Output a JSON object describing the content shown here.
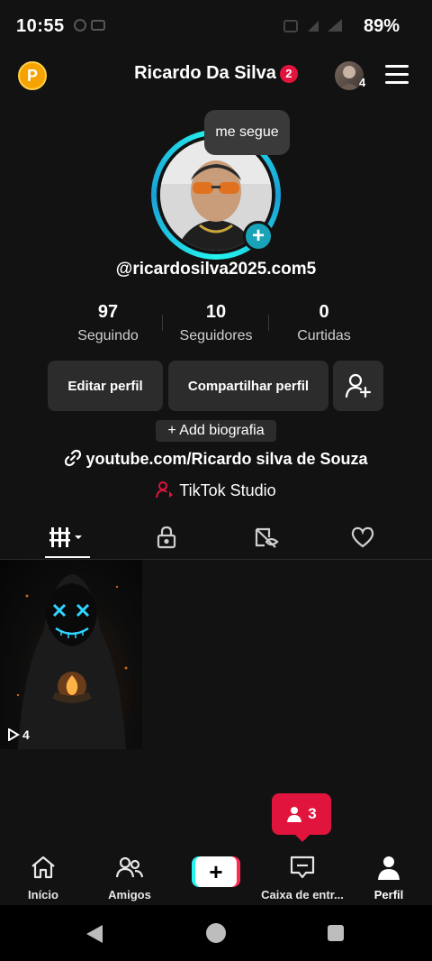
{
  "status_bar": {
    "time": "10:55",
    "battery": "89%"
  },
  "header": {
    "coin_label": "P",
    "title": "Ricardo Da Silva",
    "title_badge": "2",
    "account_count": "4"
  },
  "profile": {
    "bubble_text": "me segue",
    "username": "@ricardosilva2025.com5",
    "stats": [
      {
        "value": "97",
        "label": "Seguindo"
      },
      {
        "value": "10",
        "label": "Seguidores"
      },
      {
        "value": "0",
        "label": "Curtidas"
      }
    ],
    "buttons": {
      "edit": "Editar perfil",
      "share": "Compartilhar perfil"
    },
    "add_bio": "+ Add biografia",
    "link": "youtube.com/Ricardo silva de Souza",
    "studio": "TikTok Studio"
  },
  "tabs": [
    {
      "icon": "grid-icon",
      "active": true
    },
    {
      "icon": "lock-icon",
      "active": false
    },
    {
      "icon": "hidden-tag-icon",
      "active": false
    },
    {
      "icon": "heart-icon",
      "active": false
    }
  ],
  "videos": [
    {
      "views": "4"
    }
  ],
  "inbox_popup": {
    "count": "3"
  },
  "bottom_nav": [
    {
      "label": "Início"
    },
    {
      "label": "Amigos"
    },
    {
      "label": ""
    },
    {
      "label": "Caixa de entr..."
    },
    {
      "label": "Perfil",
      "active": true
    }
  ],
  "colors": {
    "accent_red": "#e0143c",
    "accent_cyan": "#25f4ee",
    "coin": "#f5a300"
  }
}
